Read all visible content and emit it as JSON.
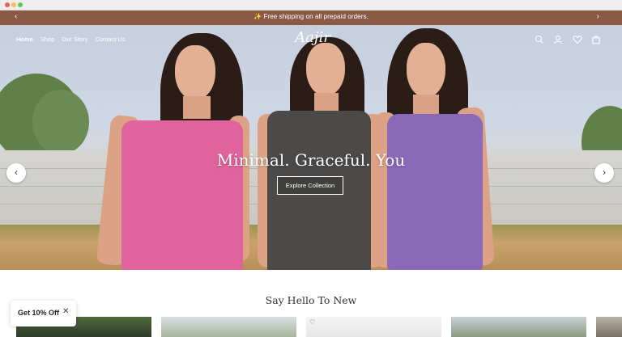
{
  "announcement": {
    "text": "✨ Free shipping on all prepaid orders.",
    "prev_arrow": "‹",
    "next_arrow": "›"
  },
  "brand": {
    "logo_text": "Aajir"
  },
  "nav": {
    "items": [
      {
        "label": "Home",
        "active": true
      },
      {
        "label": "Shop"
      },
      {
        "label": "Our Story"
      },
      {
        "label": "Contact Us"
      }
    ],
    "icons": [
      "search-icon",
      "account-icon",
      "wishlist-icon",
      "cart-icon"
    ]
  },
  "hero": {
    "title": "Minimal. Graceful. You",
    "cta_label": "Explore Collection",
    "prev_arrow": "‹",
    "next_arrow": "›"
  },
  "section": {
    "title": "Say Hello To New"
  },
  "promo": {
    "label": "Get 10% Off",
    "close": "✕"
  },
  "colors": {
    "announcement_bg": "#8a5a47",
    "pink_dress": "#e0639b",
    "grey_dress": "#4b4a49",
    "purple_dress": "#8a69b8"
  }
}
